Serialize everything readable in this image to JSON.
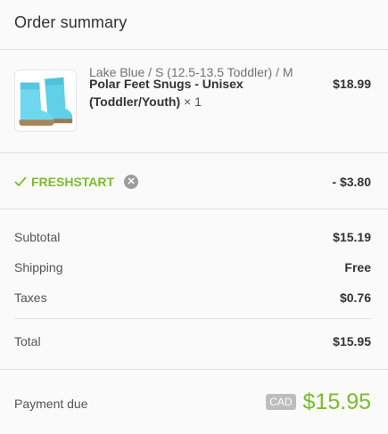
{
  "header": {
    "title": "Order summary"
  },
  "product": {
    "name": "Polar Feet Snugs - Unisex (Toddler/Youth)",
    "quantity": "× 1",
    "variant": "Lake Blue / S (12.5-13.5 Toddler) / M",
    "price": "$18.99",
    "image_icon": "slipper-boots-image",
    "image_colors": {
      "body": "#5fd0e8",
      "sole": "#9b7a52"
    }
  },
  "discount": {
    "code": "FRESHSTART",
    "amount": "- $3.80",
    "color": "#7dbb2c"
  },
  "totals": {
    "subtotal_label": "Subtotal",
    "subtotal_value": "$15.19",
    "shipping_label": "Shipping",
    "shipping_value": "Free",
    "taxes_label": "Taxes",
    "taxes_value": "$0.76",
    "total_label": "Total",
    "total_value": "$15.95"
  },
  "payment": {
    "label": "Payment due",
    "currency": "CAD",
    "amount": "$15.95",
    "accent": "#7dbb2c"
  }
}
